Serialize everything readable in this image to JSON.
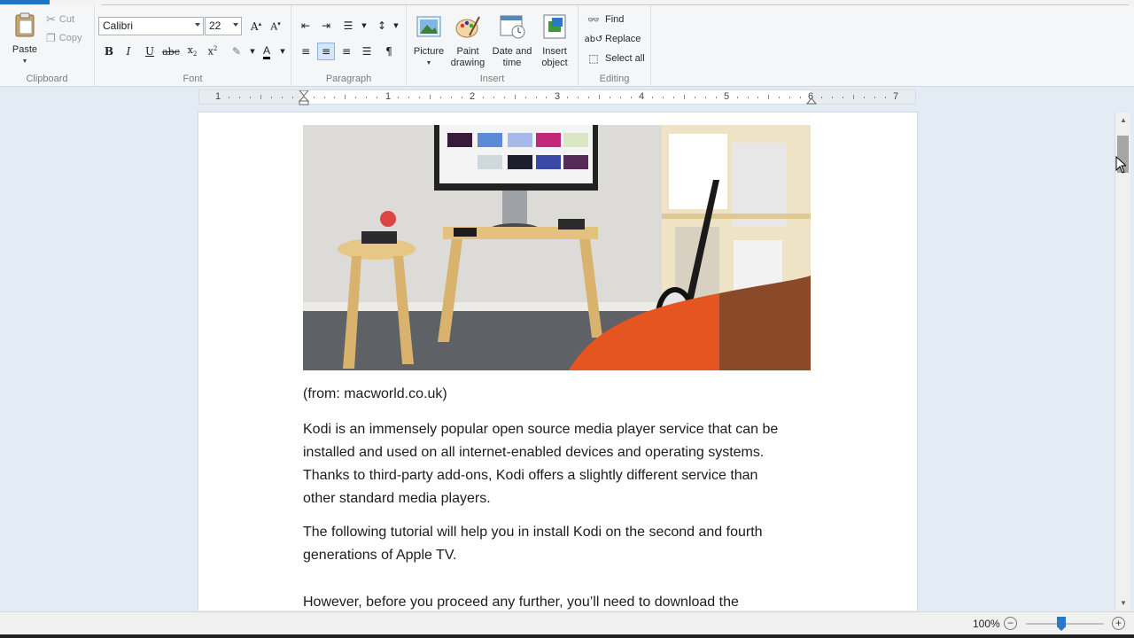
{
  "ribbon": {
    "clipboard": {
      "label": "Clipboard",
      "paste": "Paste",
      "cut": "Cut",
      "copy": "Copy"
    },
    "font": {
      "label": "Font",
      "family": "Calibri",
      "size": "22"
    },
    "paragraph": {
      "label": "Paragraph"
    },
    "insert": {
      "label": "Insert",
      "picture": "Picture",
      "paint_drawing_line1": "Paint",
      "paint_drawing_line2": "drawing",
      "date_time_line1": "Date and",
      "date_time_line2": "time",
      "insert_object_line1": "Insert",
      "insert_object_line2": "object"
    },
    "editing": {
      "label": "Editing",
      "find": "Find",
      "replace": "Replace",
      "select_all": "Select all"
    }
  },
  "ruler": {
    "numbers": [
      "1",
      "1",
      "2",
      "3",
      "4",
      "5",
      "6",
      "7"
    ]
  },
  "document": {
    "caption": "(from: macworld.co.uk)",
    "para1_lines": [
      "Kodi is an immensely popular open source media player service that can be",
      "installed and used on all internet-enabled devices and operating systems.",
      "Thanks to third-party add-ons, Kodi offers a slightly different service than",
      "other standard media players."
    ],
    "para2_lines": [
      "The following tutorial will help you in install Kodi on the second and fourth",
      "generations of Apple TV."
    ],
    "para3_line": "However, before you proceed any further, you’ll need to download the"
  },
  "status": {
    "zoom": "100%",
    "zoom_level": 0.45
  },
  "colors": {
    "accent": "#1e73c8",
    "page": "#ffffff",
    "workspace": "#e3ebf5"
  }
}
